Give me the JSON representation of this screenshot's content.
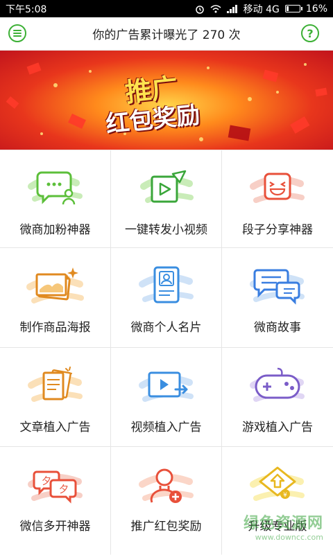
{
  "status_bar": {
    "time": "下午5:08",
    "carrier": "移动 4G",
    "battery_percent": "16%",
    "battery_level": 0.16
  },
  "header": {
    "title": "你的广告累计曝光了  270  次",
    "help_label": "?",
    "menu_icon": "menu-icon"
  },
  "banner": {
    "line1": "推广",
    "line2": "红包奖励"
  },
  "grid": {
    "items": [
      {
        "label": "微商加粉神器",
        "icon": "chat-add-friends-icon"
      },
      {
        "label": "一键转发小视频",
        "icon": "video-forward-icon"
      },
      {
        "label": "段子分享神器",
        "icon": "laugh-face-icon"
      },
      {
        "label": "制作商品海报",
        "icon": "poster-image-icon"
      },
      {
        "label": "微商个人名片",
        "icon": "business-card-icon"
      },
      {
        "label": "微商故事",
        "icon": "story-chat-icon"
      },
      {
        "label": "文章植入广告",
        "icon": "article-icon"
      },
      {
        "label": "视频植入广告",
        "icon": "video-ad-icon"
      },
      {
        "label": "游戏植入广告",
        "icon": "gamepad-icon"
      },
      {
        "label": "微信多开神器",
        "icon": "multi-open-icon"
      },
      {
        "label": "推广红包奖励",
        "icon": "user-add-icon"
      },
      {
        "label": "升级专业版",
        "icon": "upgrade-icon"
      }
    ]
  },
  "watermark": {
    "line1": "绿色资源网",
    "line2": "www.downcc.com"
  },
  "colors": {
    "accent_green": "#3cb035",
    "icon_green": "#5cbf3a",
    "icon_red": "#e8503a",
    "icon_orange": "#f0a030",
    "icon_blue": "#3a8ee0",
    "icon_purple": "#7a5cc8"
  }
}
